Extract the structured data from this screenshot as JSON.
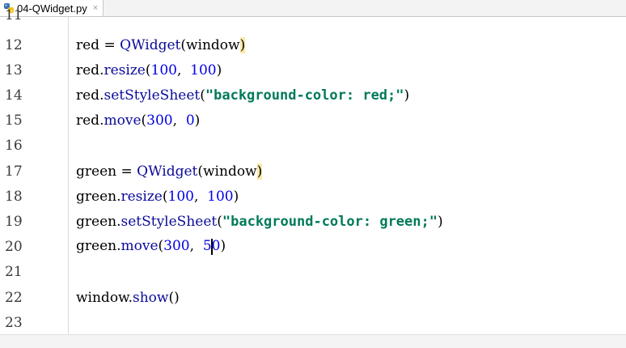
{
  "tab": {
    "filename": "04-QWidget.py",
    "close": "×"
  },
  "lines": [
    {
      "n": "11"
    },
    {
      "n": "12",
      "code": "red = QWidget(window)"
    },
    {
      "n": "13",
      "code": "red.resize(100, 100)"
    },
    {
      "n": "14",
      "code": "red.setStyleSheet(\"background-color: red;\")"
    },
    {
      "n": "15",
      "code": "red.move(300, 0)"
    },
    {
      "n": "16"
    },
    {
      "n": "17",
      "code": "green = QWidget(window)"
    },
    {
      "n": "18",
      "code": "green.resize(100, 100)"
    },
    {
      "n": "19",
      "code": "green.setStyleSheet(\"background-color: green;\")"
    },
    {
      "n": "20",
      "code": "green.move(300, 50)"
    },
    {
      "n": "21"
    },
    {
      "n": "22",
      "code": "window.show()"
    },
    {
      "n": "23"
    }
  ],
  "tokens": {
    "l12": [
      "red",
      " = ",
      "QWidget",
      "(window",
      ")"
    ],
    "l13": [
      "red.",
      "resize",
      "(",
      "100",
      ",  ",
      "100",
      ")"
    ],
    "l14": [
      "red.",
      "setStyleSheet",
      "(",
      "\"background-color: red;\"",
      ")"
    ],
    "l15": [
      "red.",
      "move",
      "(",
      "300",
      ",  ",
      "0",
      ")"
    ],
    "l17": [
      "green",
      " = ",
      "QWidget",
      "(window",
      ")"
    ],
    "l18": [
      "green.",
      "resize",
      "(",
      "100",
      ",  ",
      "100",
      ")"
    ],
    "l19": [
      "green.",
      "setStyleSheet",
      "(",
      "\"background-color: green;\"",
      ")"
    ],
    "l20": [
      "green.",
      "move",
      "(",
      "300",
      ",  ",
      "5",
      "0",
      ")"
    ],
    "l22": [
      "window.",
      "show",
      "()"
    ]
  },
  "colors": {
    "string": "#007a5a",
    "number": "#0000e6",
    "function": "#0a0a9a",
    "bracket_highlight": "#fbe9a8"
  }
}
